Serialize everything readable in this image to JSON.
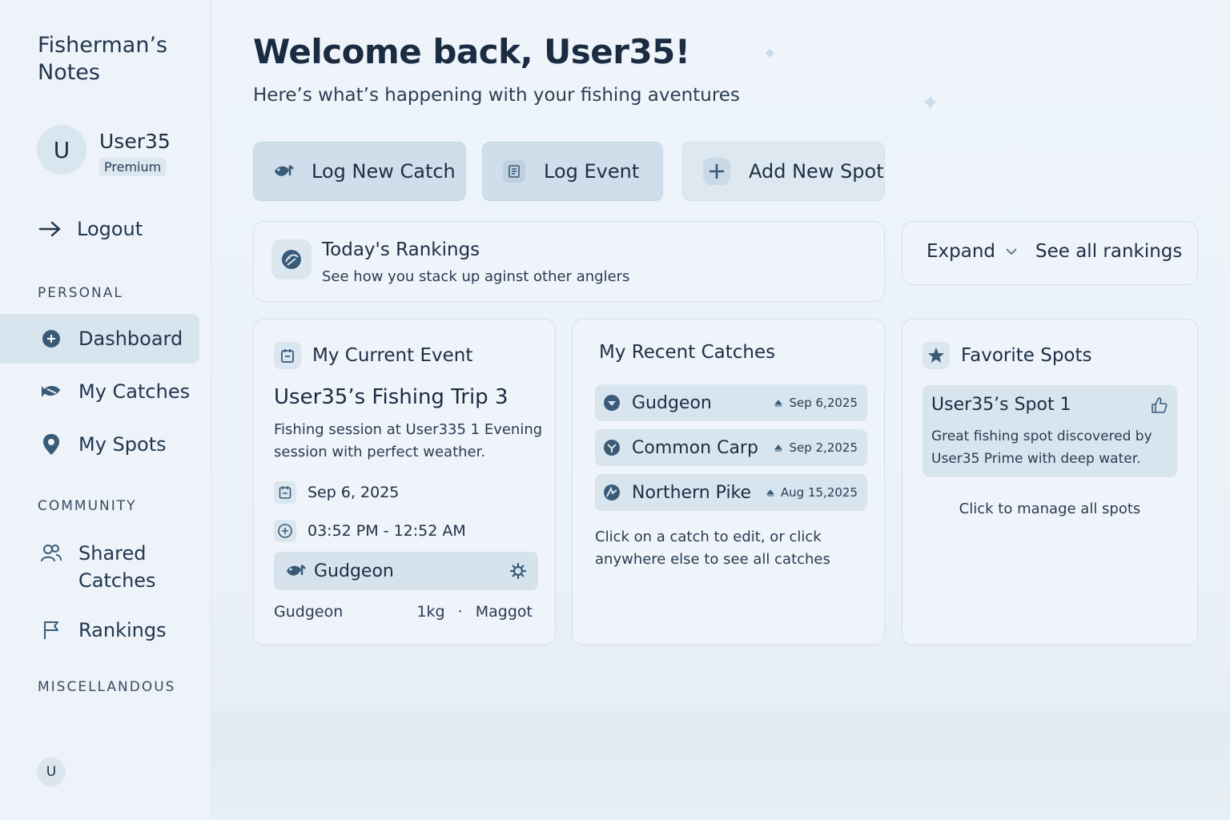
{
  "app": {
    "brand": "Fisherman’s Notes"
  },
  "user": {
    "name": "User35",
    "initial": "U",
    "plan": "Premium"
  },
  "sidebar": {
    "logout": "Logout",
    "sections": {
      "personal": "PERSONAL",
      "community": "COMMUNITY",
      "misc": "MISCELLANDOUS"
    },
    "items": [
      {
        "label": "Dashboard",
        "icon": "plus-circle-icon",
        "active": true
      },
      {
        "label": "My Catches",
        "icon": "fish-icon"
      },
      {
        "label": "My Spots",
        "icon": "map-pin-icon"
      },
      {
        "label_line1": "Shared",
        "label_line2": "Catches",
        "icon": "users-icon"
      },
      {
        "label": "Rankings",
        "icon": "flag-icon"
      }
    ]
  },
  "header": {
    "title": "Welcome back, User35!",
    "subtitle": "Here’s what’s happening with your fishing aventures"
  },
  "actions": {
    "log_catch": "Log New Catch",
    "log_event": "Log Event",
    "add_spot": "Add New Spot"
  },
  "rankings": {
    "title": "Today's Rankings",
    "subtitle": "See how you stack up aginst other anglers",
    "expand": "Expand",
    "see_all": "See all rankings"
  },
  "current_event": {
    "heading": "My Current Event",
    "title": "User35’s Fishing Trip 3",
    "description": "Fishing session at User335 1  Evening session with perfect weather.",
    "date": "Sep 6, 2025",
    "time": "03:52 PM - 12:52 AM",
    "fish": "Gudgeon",
    "footer_species": "Gudgeon",
    "footer_weight": "1kg",
    "footer_sep": "·",
    "footer_bait": "Maggot"
  },
  "recent_catches": {
    "heading": "My Recent Catches",
    "items": [
      {
        "name": "Gudgeon",
        "date": "Sep 6,2025"
      },
      {
        "name": "Common Carp",
        "date": "Sep 2,2025"
      },
      {
        "name": "Northern Pike",
        "date": "Aug 15,2025"
      }
    ],
    "hint": "Click on a catch to edit, or click anywhere else to see all catches"
  },
  "favorite_spots": {
    "heading": "Favorite Spots",
    "spot_name": "User35’s Spot 1",
    "spot_desc": "Great fishing spot discovered by User35 Prime with deep water.",
    "manage": "Click to manage all spots"
  },
  "colors": {
    "background": "#eef4fa",
    "accent": "#3a5b78",
    "button": "#cfdeea",
    "text": "#1d2e44"
  }
}
